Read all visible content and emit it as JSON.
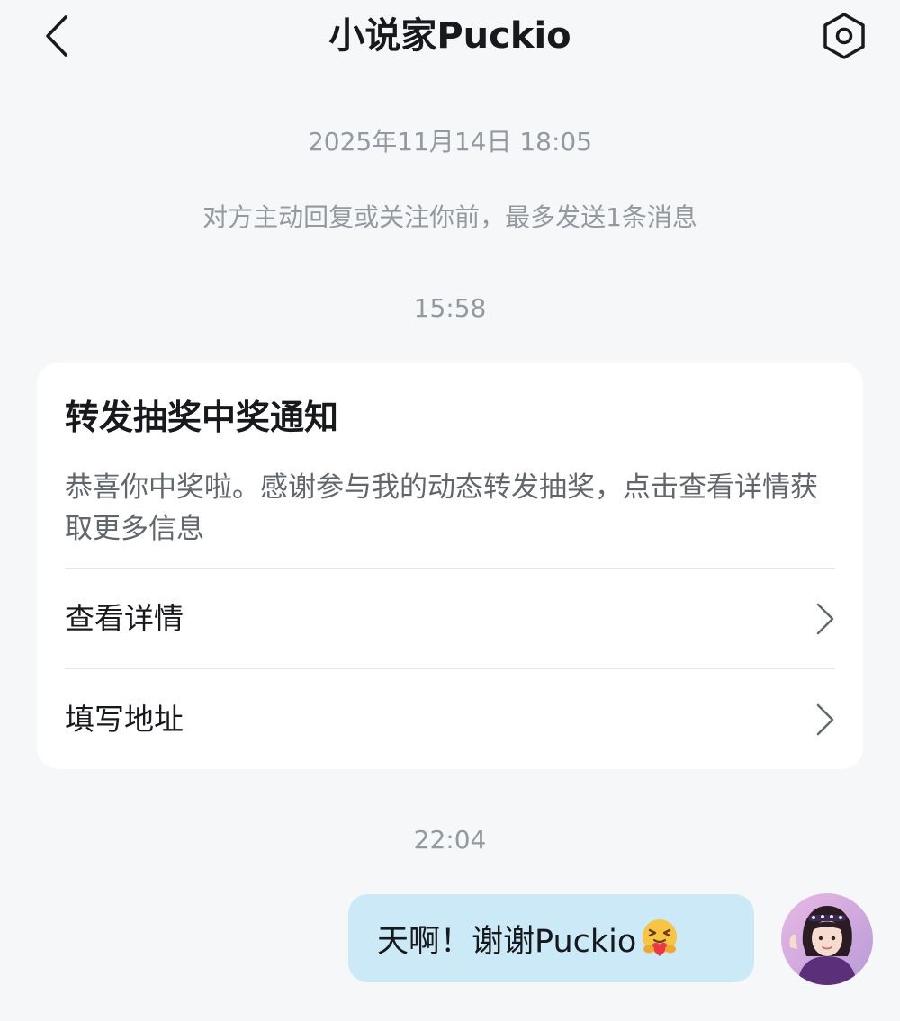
{
  "header": {
    "title": "小说家Puckio"
  },
  "chat": {
    "timestamp_1": "2025年11月14日 18:05",
    "notice": "对方主动回复或关注你前，最多发送1条消息",
    "timestamp_2": "15:58",
    "timestamp_3": "22:04"
  },
  "card": {
    "title": "转发抽奖中奖通知",
    "description": "恭喜你中奖啦。感谢参与我的动态转发抽奖，点击查看详情获取更多信息",
    "rows": [
      {
        "label": "查看详情"
      },
      {
        "label": "填写地址"
      }
    ]
  },
  "message": {
    "text": "天啊！谢谢Puckio"
  },
  "colors": {
    "background": "#f6f7f9",
    "bubble": "#cbe9f6",
    "secondary_text": "#9499a0"
  },
  "icons": {
    "back": "back-arrow-icon",
    "settings": "settings-hexagon-icon",
    "chevron": "chevron-right-icon",
    "emoji": "hugging-face-emoji-icon"
  }
}
